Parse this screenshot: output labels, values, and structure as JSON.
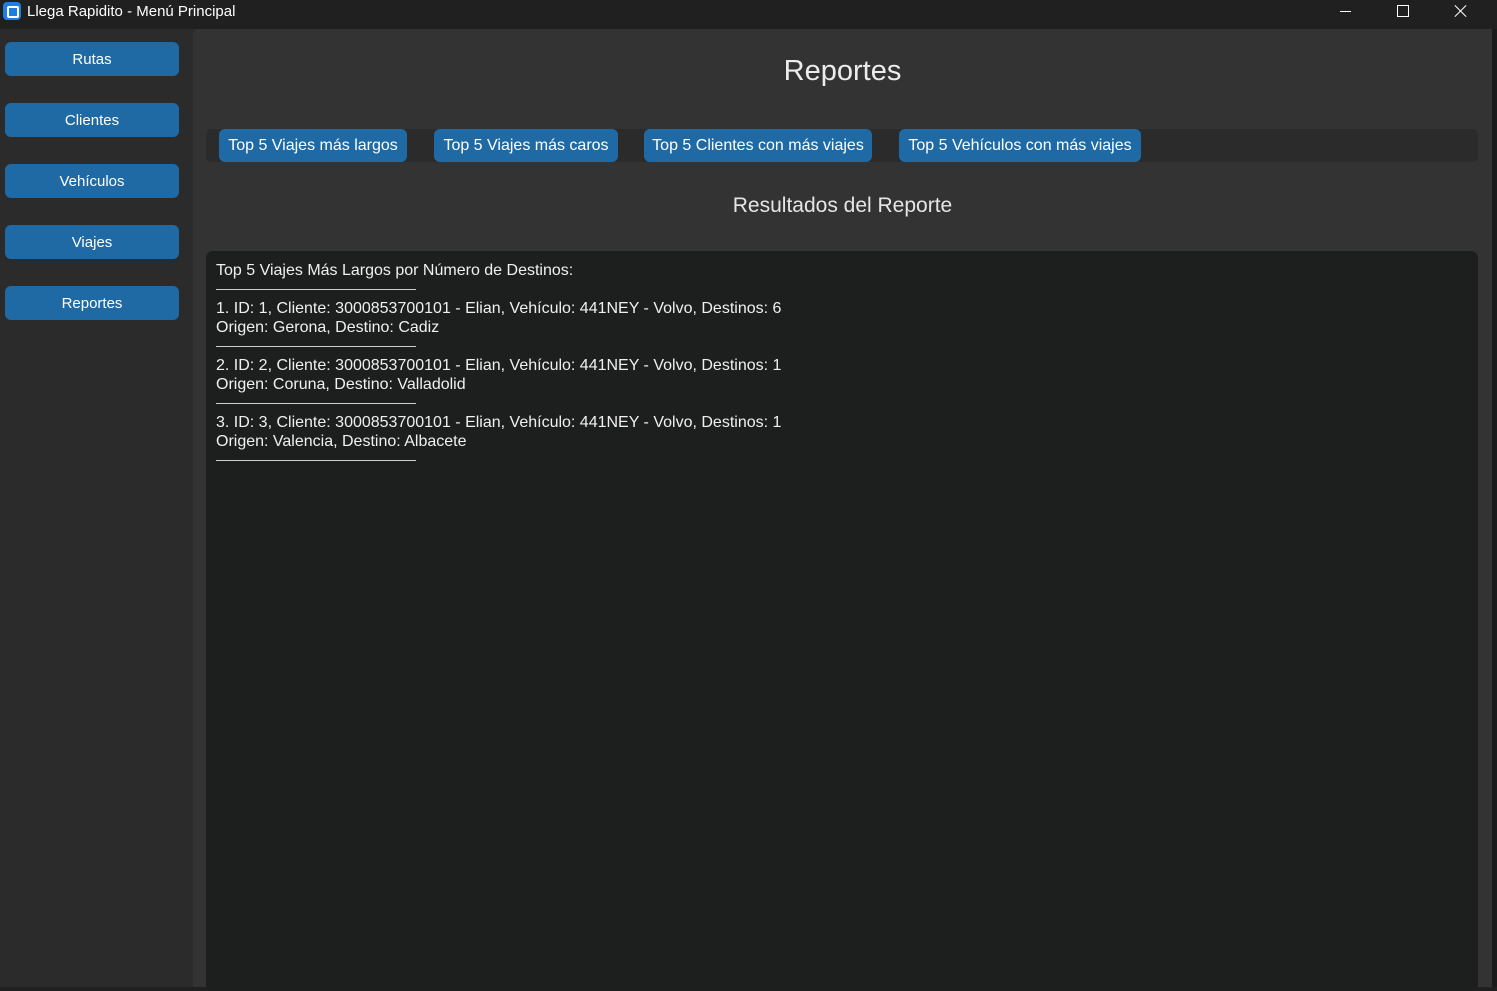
{
  "window": {
    "title": "Llega Rapidito - Menú Principal",
    "icons": {
      "app": "app-icon",
      "minimize": "minimize-icon",
      "maximize": "maximize-icon",
      "close": "close-icon"
    }
  },
  "sidebar": {
    "items": [
      {
        "label": "Rutas"
      },
      {
        "label": "Clientes"
      },
      {
        "label": "Vehículos"
      },
      {
        "label": "Viajes"
      },
      {
        "label": "Reportes"
      }
    ]
  },
  "main": {
    "title": "Reportes",
    "tabs": [
      {
        "label": "Top 5 Viajes más largos"
      },
      {
        "label": "Top 5 Viajes más caros"
      },
      {
        "label": "Top 5 Clientes con más viajes"
      },
      {
        "label": "Top 5 Vehículos con más viajes"
      }
    ],
    "results_title": "Resultados del Reporte",
    "results": {
      "heading": "Top 5 Viajes Más Largos por Número de Destinos:",
      "entries": [
        {
          "line1": "1. ID: 1, Cliente: 3000853700101 - Elian, Vehículo: 441NEY - Volvo, Destinos: 6",
          "line2": "Origen: Gerona, Destino: Cadiz"
        },
        {
          "line1": "2. ID: 2, Cliente: 3000853700101 - Elian, Vehículo: 441NEY - Volvo, Destinos: 1",
          "line2": "Origen: Coruna, Destino: Valladolid"
        },
        {
          "line1": "3. ID: 3, Cliente: 3000853700101 - Elian, Vehículo: 441NEY - Volvo, Destinos: 1",
          "line2": "Origen: Valencia, Destino: Albacete"
        }
      ]
    }
  },
  "colors": {
    "accent": "#1f6aa5",
    "titlebar": "#202020",
    "sidebar": "#2b2b2b",
    "main": "#333333",
    "results_bg": "#1d1e1e"
  }
}
